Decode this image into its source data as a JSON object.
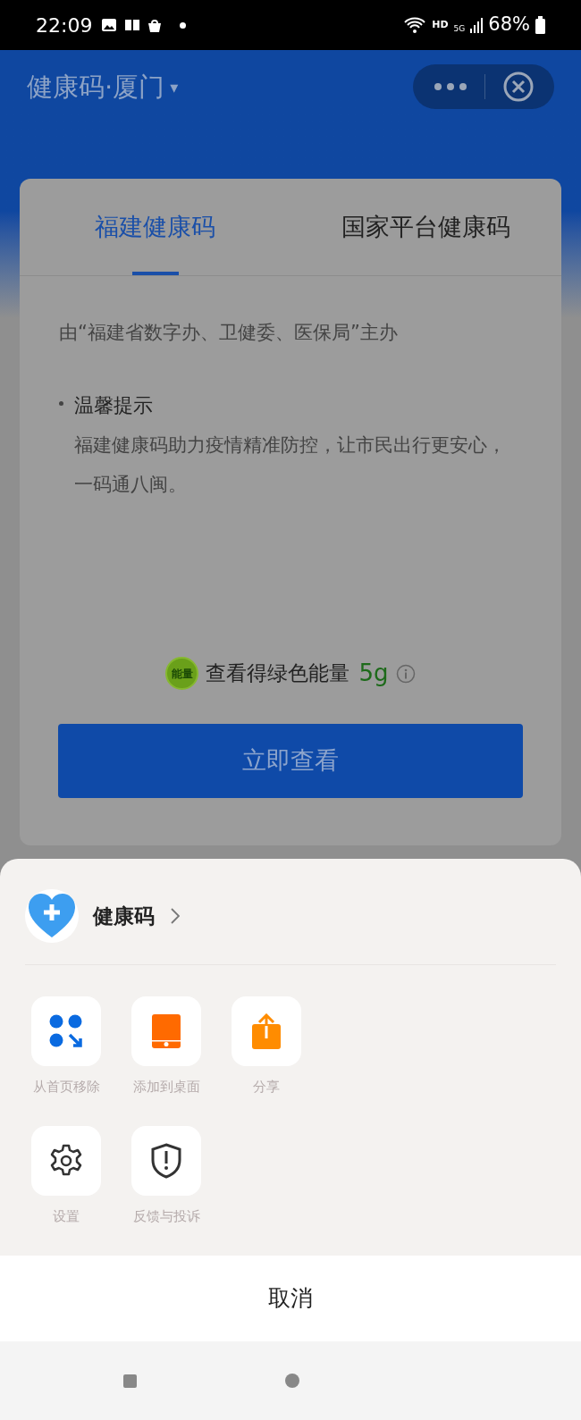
{
  "status_bar": {
    "time": "22:09",
    "network": "HD",
    "generation": "5G",
    "battery": "68%"
  },
  "header": {
    "title": "健康码·厦门",
    "caret": "▾"
  },
  "tabs": [
    {
      "label": "福建健康码",
      "selected": true
    },
    {
      "label": "国家平台健康码",
      "selected": false
    }
  ],
  "card": {
    "sponsor": "由“福建省数字办、卫健委、医保局”主办",
    "tip_title": "温馨提示",
    "tip_text": "福建健康码助力疫情精准防控，让市民出行更安心，一码通八闽。",
    "energy_badge": "能量",
    "energy_text": "查看得绿色能量",
    "energy_amount": "5g",
    "button": "立即查看"
  },
  "sheet": {
    "app_name": "健康码",
    "actions": [
      {
        "kind": "remove",
        "label": "从首页移除"
      },
      {
        "kind": "desktop",
        "label": "添加到桌面"
      },
      {
        "kind": "share",
        "label": "分享"
      },
      {
        "kind": "settings",
        "label": "设置"
      },
      {
        "kind": "feedback",
        "label": "反馈与投诉"
      }
    ],
    "cancel": "取消"
  }
}
